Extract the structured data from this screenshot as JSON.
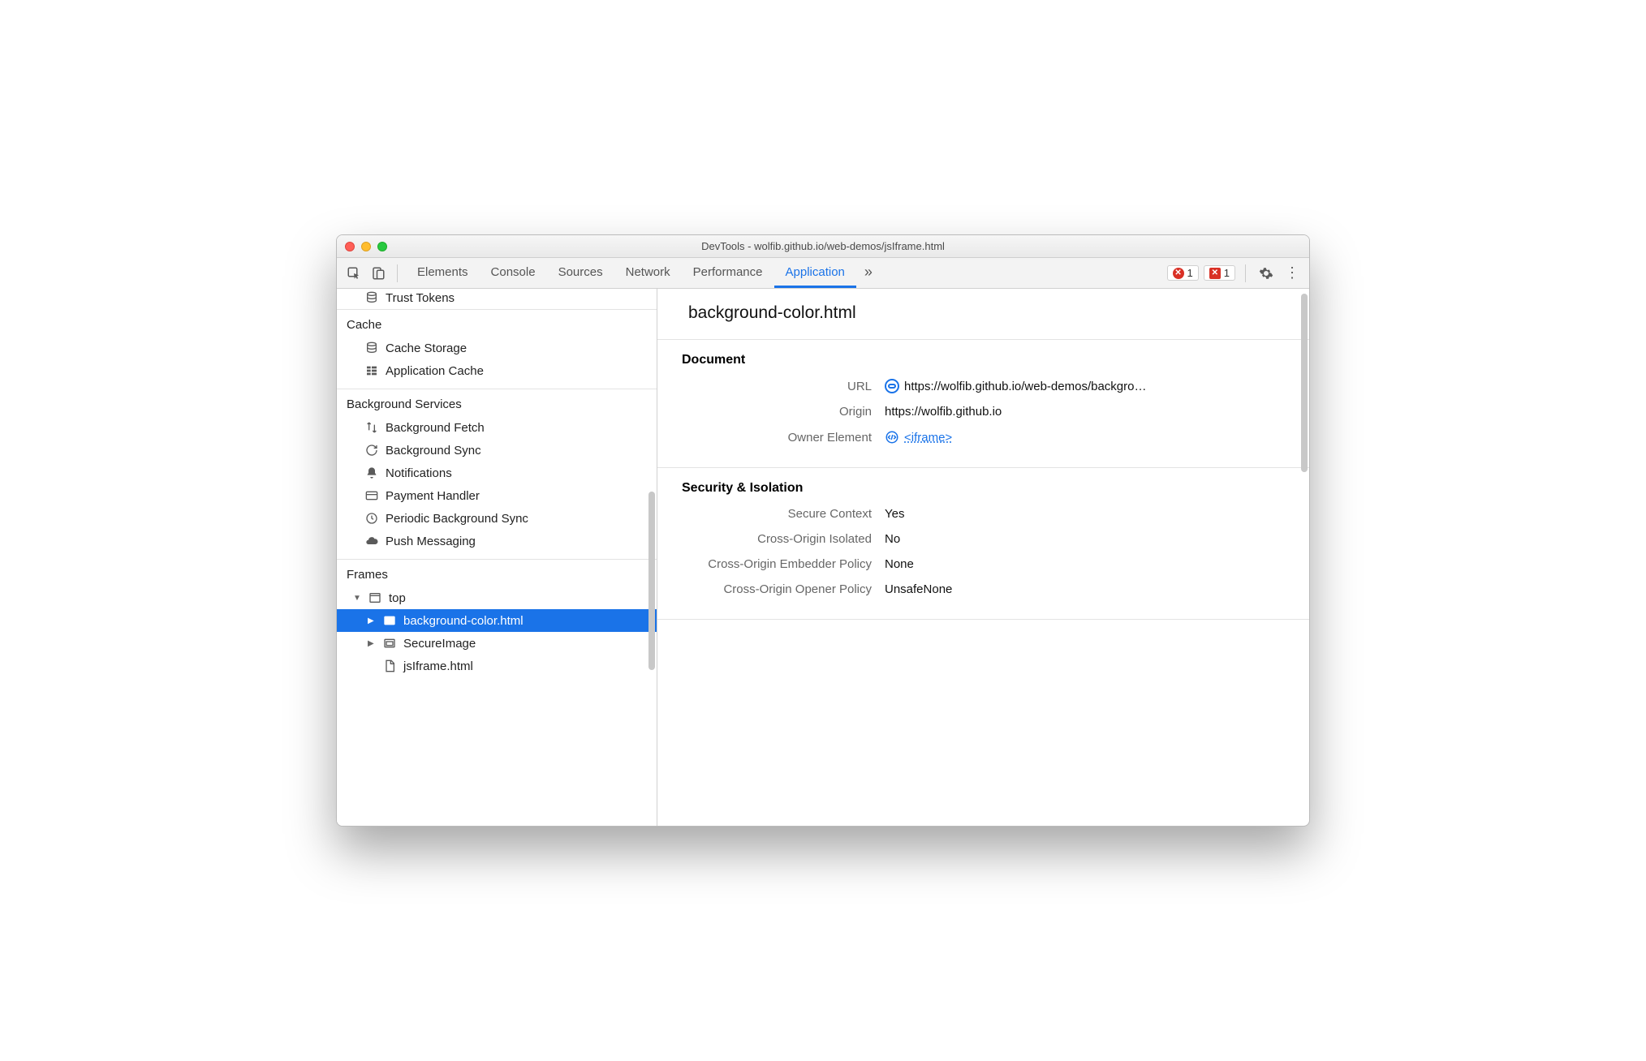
{
  "window": {
    "title": "DevTools - wolfib.github.io/web-demos/jsIframe.html"
  },
  "toolbar": {
    "tabs": [
      {
        "label": "Elements"
      },
      {
        "label": "Console"
      },
      {
        "label": "Sources"
      },
      {
        "label": "Network"
      },
      {
        "label": "Performance"
      },
      {
        "label": "Application",
        "active": true
      }
    ],
    "error_count": "1",
    "issue_count": "1"
  },
  "sidebar": {
    "trust_tokens": "Trust Tokens",
    "groups": {
      "cache": {
        "label": "Cache",
        "items": [
          {
            "label": "Cache Storage"
          },
          {
            "label": "Application Cache"
          }
        ]
      },
      "bg": {
        "label": "Background Services",
        "items": [
          {
            "label": "Background Fetch"
          },
          {
            "label": "Background Sync"
          },
          {
            "label": "Notifications"
          },
          {
            "label": "Payment Handler"
          },
          {
            "label": "Periodic Background Sync"
          },
          {
            "label": "Push Messaging"
          }
        ]
      },
      "frames": {
        "label": "Frames",
        "top": "top",
        "children": [
          {
            "label": "background-color.html",
            "selected": true
          },
          {
            "label": "SecureImage"
          },
          {
            "label": "jsIframe.html"
          }
        ]
      }
    }
  },
  "main": {
    "title": "background-color.html",
    "doc": {
      "heading": "Document",
      "url_label": "URL",
      "url_value": "https://wolfib.github.io/web-demos/backgro…",
      "origin_label": "Origin",
      "origin_value": "https://wolfib.github.io",
      "owner_label": "Owner Element",
      "owner_value": "<iframe>"
    },
    "sec": {
      "heading": "Security & Isolation",
      "rows": [
        {
          "k": "Secure Context",
          "v": "Yes"
        },
        {
          "k": "Cross-Origin Isolated",
          "v": "No"
        },
        {
          "k": "Cross-Origin Embedder Policy",
          "v": "None"
        },
        {
          "k": "Cross-Origin Opener Policy",
          "v": "UnsafeNone"
        }
      ]
    }
  }
}
